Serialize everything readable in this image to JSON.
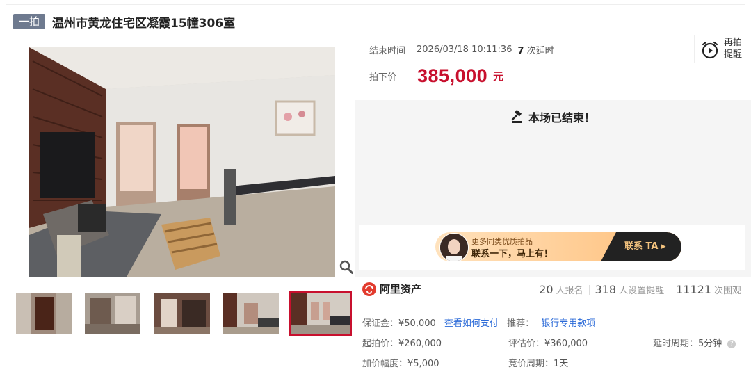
{
  "header": {
    "tag": "一拍",
    "title": "温州市黄龙住宅区凝霞15幢306室"
  },
  "auction": {
    "end_time_label": "结束时间",
    "end_time_value": "2026/03/18 10:11:36",
    "extension_count": "7",
    "extension_suffix": "次延时",
    "price_label": "拍下价",
    "price_value": "385,000",
    "price_unit": "元",
    "remind_line1": "再拍",
    "remind_line2": "提醒",
    "ended_text": "本场已结束！"
  },
  "banner": {
    "subtitle": "更多同类优质拍品",
    "headline": "联系一下，马上有！",
    "button": "联系 TA ▸"
  },
  "brand": {
    "name": "阿里资产"
  },
  "stats": [
    {
      "count": "20",
      "label": "人报名"
    },
    {
      "count": "318",
      "label": "人设置提醒"
    },
    {
      "count": "11121",
      "label": "次围观"
    }
  ],
  "details": {
    "deposit_label": "保证金：",
    "deposit_value": "¥50,000",
    "pay_link": "查看如何支付",
    "recommend_label": "推荐：",
    "recommend_link": "银行专用款项",
    "start_price_label": "起拍价：",
    "start_price_value": "¥260,000",
    "assess_label": "评估价：",
    "assess_value": "¥360,000",
    "delay_label": "延时周期：",
    "delay_value": "5分钟",
    "increment_label": "加价幅度：",
    "increment_value": "¥5,000",
    "bid_cycle_label": "竞价周期：",
    "bid_cycle_value": "1天"
  },
  "colors": {
    "accent_red": "#c8102e",
    "tag_bg": "#6e7a8f",
    "link_blue": "#2c6bd8"
  },
  "icons": [
    "zoom-icon",
    "alarm-clock-icon",
    "auction-hammer-icon",
    "help-icon",
    "ali-asset-logo-icon"
  ]
}
